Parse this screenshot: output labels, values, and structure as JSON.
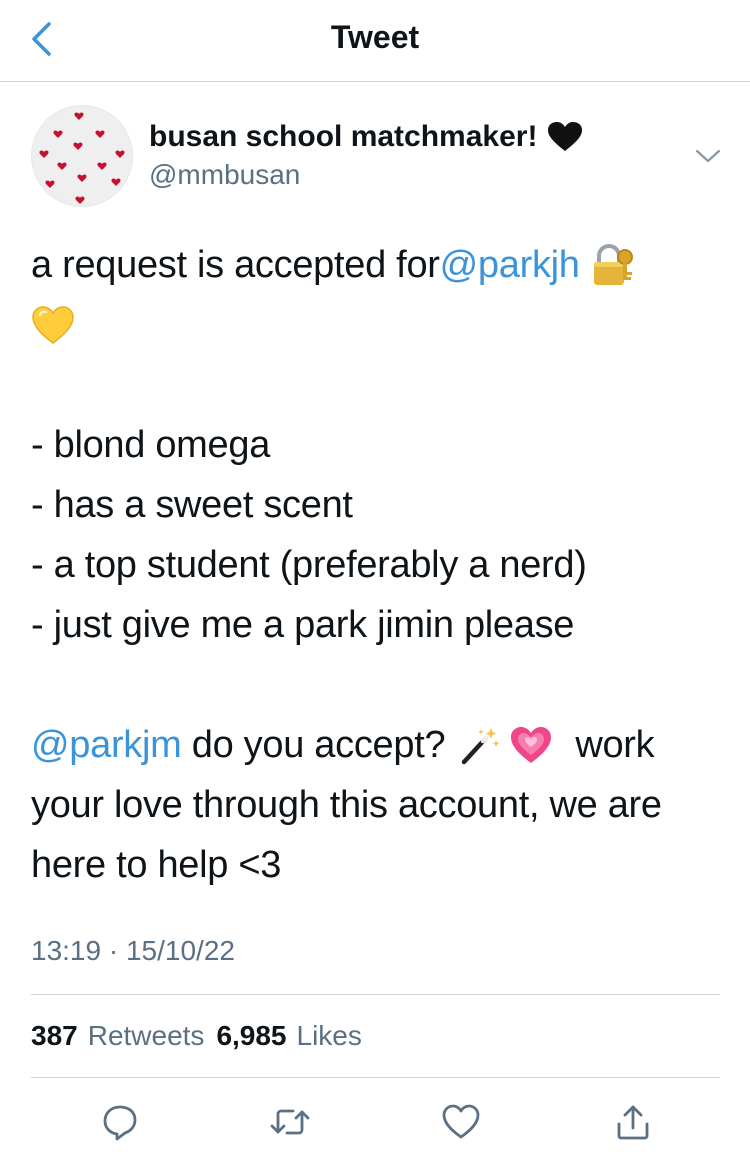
{
  "header": {
    "title": "Tweet",
    "back_icon": "chevron-left-icon"
  },
  "author": {
    "display_name": "busan school matchmaker!",
    "name_emoji": "black-heart-icon",
    "handle": "@mmbusan",
    "avatar": "red-hearts-pattern-avatar"
  },
  "tweet": {
    "line1_text": "a request is accepted for ",
    "line1_mention": "@parkjh",
    "line1_emoji": "locked-with-key-icon",
    "line2_emoji": "yellow-heart-icon",
    "items": [
      "- blond omega",
      "- has a sweet scent",
      "- a top student (preferably a nerd)",
      "- just give me a park jimin please"
    ],
    "line7_mention": "@parkjm",
    "line7_text": " do you accept?",
    "line7_emoji1": "magic-wand-icon",
    "line7_emoji2": "growing-heart-icon",
    "line7_tail": "work",
    "line8": "your love through this account, we are",
    "line9": "here to help <3"
  },
  "meta": {
    "time": "13:19",
    "separator": "·",
    "date": "15/10/22"
  },
  "stats": {
    "retweets_count": "387",
    "retweets_label": "Retweets",
    "likes_count": "6,985",
    "likes_label": "Likes"
  },
  "actions": {
    "reply_icon": "reply-icon",
    "retweet_icon": "retweet-icon",
    "like_icon": "heart-outline-icon",
    "share_icon": "share-icon"
  },
  "colors": {
    "link": "#3b94d9",
    "secondary": "#5b7083",
    "back_arrow": "#3b94d9",
    "divider": "#cfd4d8"
  }
}
